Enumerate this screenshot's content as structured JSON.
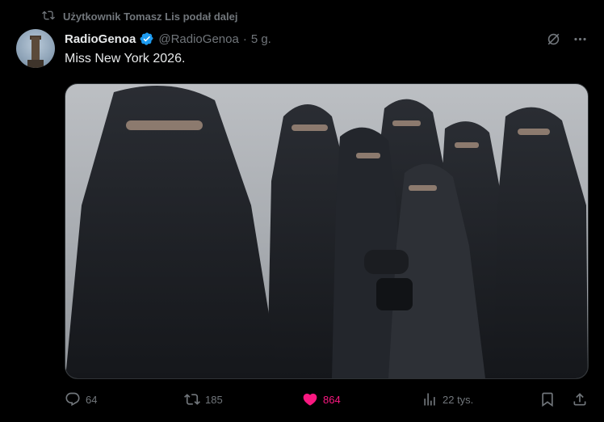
{
  "retweet": {
    "text": "Użytkownik Tomasz Lis podał dalej",
    "icon": "retweet-icon"
  },
  "tweet": {
    "display_name": "RadioGenoa",
    "handle": "@RadioGenoa",
    "separator": "·",
    "time": "5 g.",
    "text": "Miss New York 2026.",
    "verified_color": "#1d9bf0"
  },
  "actions": {
    "replies": "64",
    "retweets": "185",
    "likes": "864",
    "views": "22 tys."
  },
  "colors": {
    "background": "#000000",
    "text": "#e7e9ea",
    "muted": "#71767b",
    "like": "#f91880",
    "border": "#2f3336"
  }
}
